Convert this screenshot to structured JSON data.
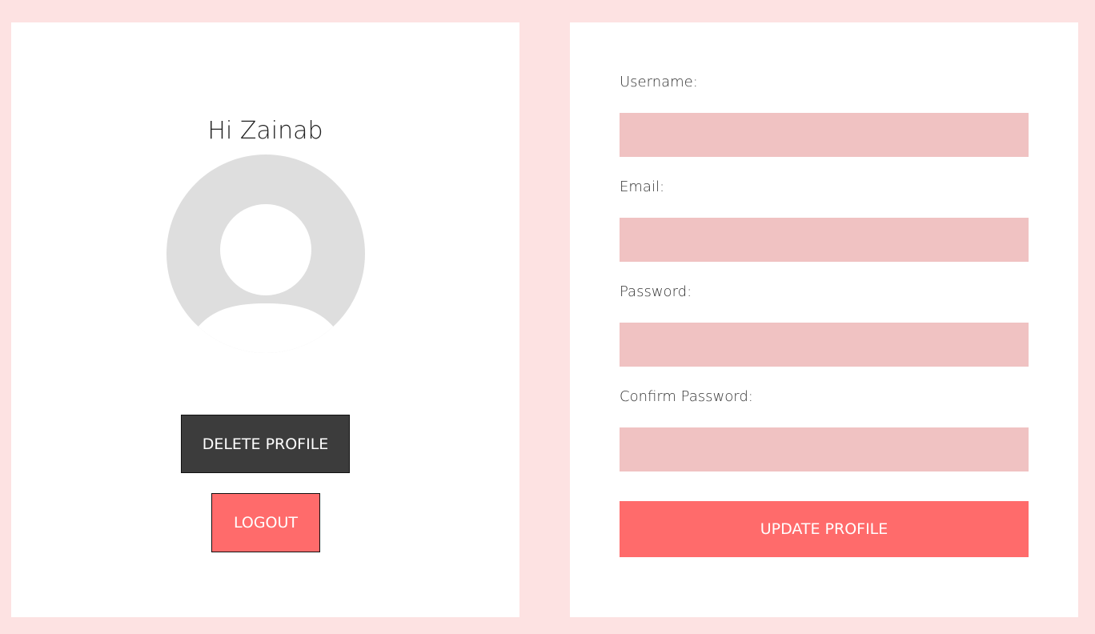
{
  "profile_card": {
    "greeting": "Hi Zainab",
    "avatar_icon": "user-silhouette-icon",
    "delete_button": "DELETE PROFILE",
    "logout_button": "LOGOUT"
  },
  "form": {
    "username_label": "Username:",
    "username_value": "",
    "email_label": "Email:",
    "email_value": "",
    "password_label": "Password:",
    "password_value": "",
    "confirm_password_label": "Confirm Password:",
    "confirm_password_value": "",
    "update_button": "UPDATE PROFILE"
  },
  "colors": {
    "page_background": "#fde2e2",
    "card_background": "#ffffff",
    "input_fill": "#f0c2c2",
    "accent": "#ff6b6b",
    "dark_button": "#3c3c3c",
    "avatar_grey": "#dedede"
  }
}
